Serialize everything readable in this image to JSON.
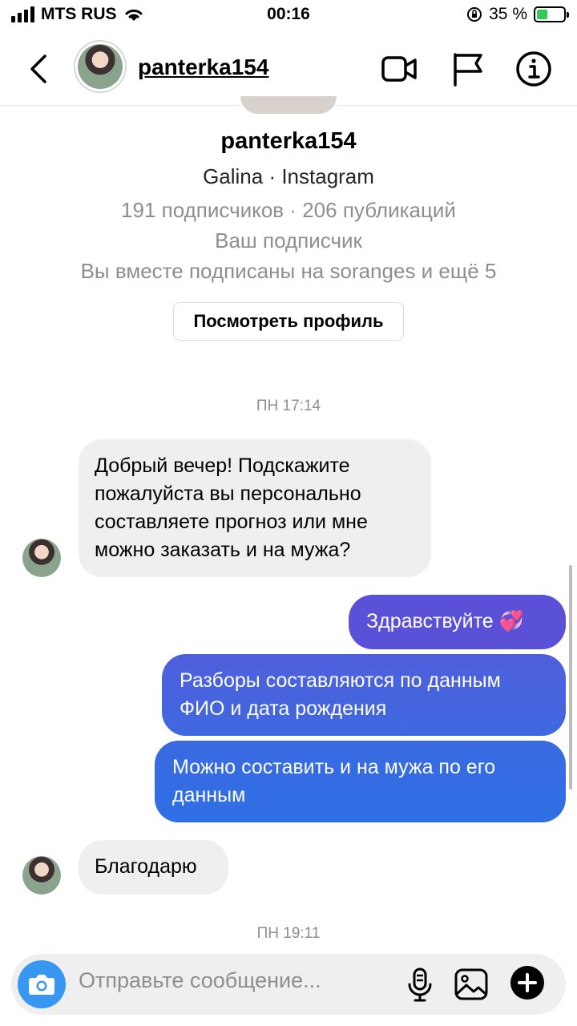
{
  "status_bar": {
    "carrier": "MTS RUS",
    "time": "00:16",
    "battery": "35 %"
  },
  "header": {
    "username": "panterka154"
  },
  "profile": {
    "username": "panterka154",
    "subtitle": "Galina · Instagram",
    "stats": "191 подписчиков · 206 публикаций",
    "follow_status": "Ваш подписчик",
    "mutual": "Вы вместе подписаны на soranges и ещё 5",
    "view_button": "Посмотреть профиль"
  },
  "timestamps": [
    "ПН 17:14",
    "ПН 19:11"
  ],
  "messages": [
    {
      "from": "them",
      "text": "Добрый вечер! Подскажите пожалуйста вы персонально составляете прогноз или мне можно заказать и на мужа?"
    },
    {
      "from": "me",
      "text": "Здравствуйте",
      "emoji": "💞"
    },
    {
      "from": "me",
      "text": "Разборы составляются по данным ФИО и дата рождения"
    },
    {
      "from": "me",
      "text": "Можно составить и на мужа по его данным"
    },
    {
      "from": "them",
      "text": "Благодарю"
    }
  ],
  "composer": {
    "placeholder": "Отправьте сообщение..."
  },
  "colors": {
    "accent": "#3897f0",
    "bubble_in": "#efefef",
    "bubble_out_top": "#5b51d8",
    "bubble_out_bottom": "#2f6fe4"
  },
  "icons": [
    "back-icon",
    "video-call-icon",
    "flag-icon",
    "info-icon",
    "camera-icon",
    "microphone-icon",
    "gallery-icon",
    "plus-icon"
  ]
}
